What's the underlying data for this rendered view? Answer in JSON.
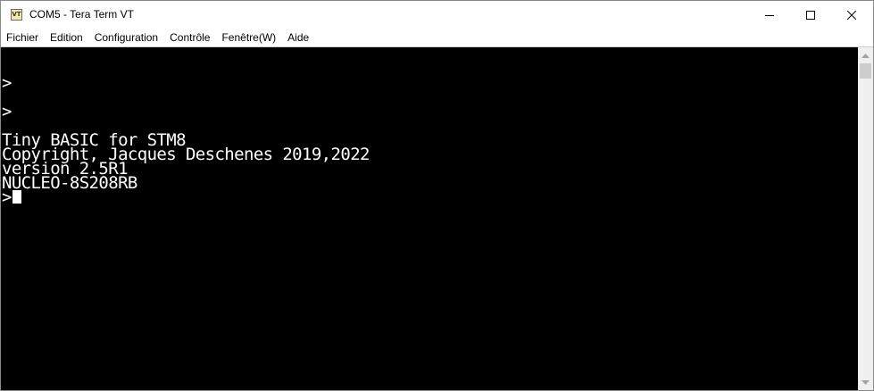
{
  "window": {
    "title": "COM5 - Tera Term VT",
    "icon_text": "VT",
    "icon_name": "teraterm-vt-icon"
  },
  "menu": {
    "items": [
      {
        "label": "Fichier"
      },
      {
        "label": "Edition"
      },
      {
        "label": "Configuration"
      },
      {
        "label": "Contrôle"
      },
      {
        "label": "Fenêtre(W)"
      },
      {
        "label": "Aide"
      }
    ]
  },
  "terminal": {
    "background": "#000000",
    "foreground": "#ffffff",
    "lines": [
      ">",
      ">",
      "Tiny BASIC for STM8",
      "Copyright, Jacques Deschenes 2019,2022",
      "version 2.5R1",
      "NUCLEO-8S208RB",
      ">"
    ]
  }
}
